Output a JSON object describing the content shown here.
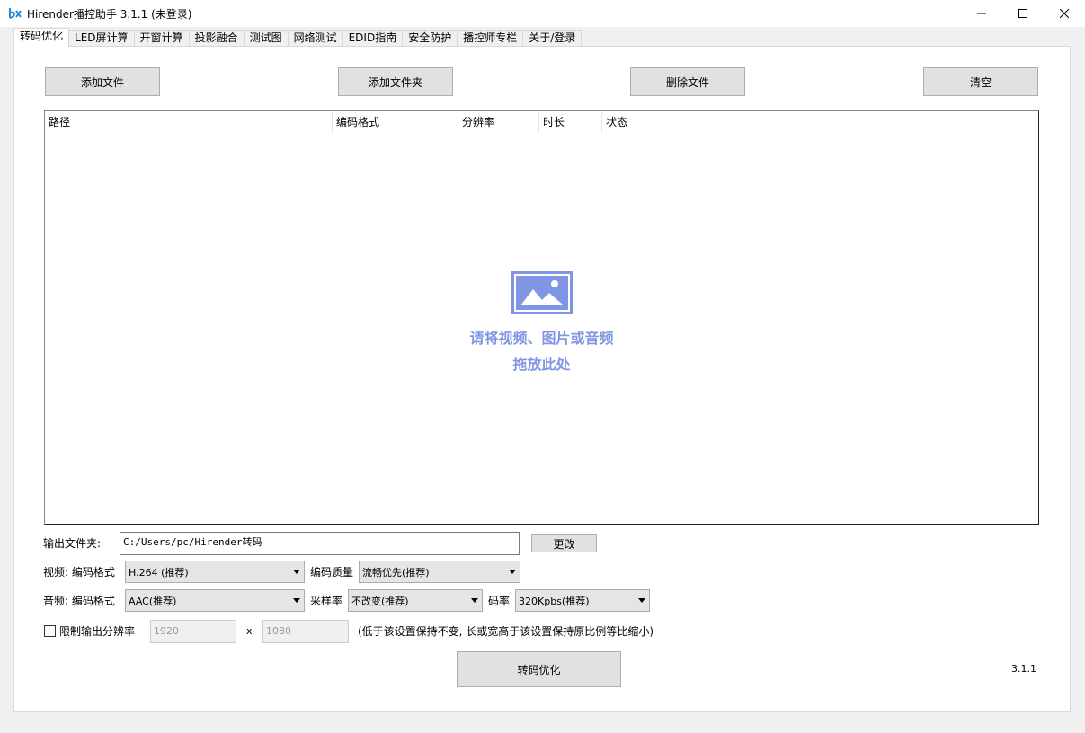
{
  "window": {
    "title": "Hirender播控助手 3.1.1 (未登录)"
  },
  "tabs": [
    {
      "label": "转码优化",
      "active": true
    },
    {
      "label": "LED屏计算"
    },
    {
      "label": "开窗计算"
    },
    {
      "label": "投影融合"
    },
    {
      "label": "测试图"
    },
    {
      "label": "网络测试"
    },
    {
      "label": "EDID指南"
    },
    {
      "label": "安全防护"
    },
    {
      "label": "播控师专栏"
    },
    {
      "label": "关于/登录"
    }
  ],
  "toolbar": {
    "add_file": "添加文件",
    "add_folder": "添加文件夹",
    "delete_file": "删除文件",
    "clear": "清空"
  },
  "file_list": {
    "columns": [
      "路径",
      "编码格式",
      "分辨率",
      "时长",
      "状态"
    ],
    "rows": [],
    "drop_hint_line1": "请将视频、图片或音频",
    "drop_hint_line2": "拖放此处"
  },
  "output": {
    "label": "输出文件夹:",
    "path": "C:/Users/pc/Hirender转码",
    "change_button": "更改"
  },
  "video": {
    "label": "视频: 编码格式",
    "codec": "H.264 (推荐)",
    "quality_label": "编码质量",
    "quality": "流畅优先(推荐)"
  },
  "audio": {
    "label": "音频: 编码格式",
    "codec": "AAC(推荐)",
    "samplerate_label": "采样率",
    "samplerate": "不改变(推荐)",
    "bitrate_label": "码率",
    "bitrate": "320Kpbs(推荐)"
  },
  "limit": {
    "label": "限制输出分辨率",
    "checked": false,
    "width": "1920",
    "separator": "x",
    "height": "1080",
    "hint": "(低于该设置保持不变, 长或宽高于该设置保持原比例等比缩小)"
  },
  "actions": {
    "transcode": "转码优化"
  },
  "version": "3.1.1",
  "colors": {
    "accent": "#8096e4",
    "window_bg": "#f0f0f0",
    "button_bg": "#e1e1e1"
  }
}
